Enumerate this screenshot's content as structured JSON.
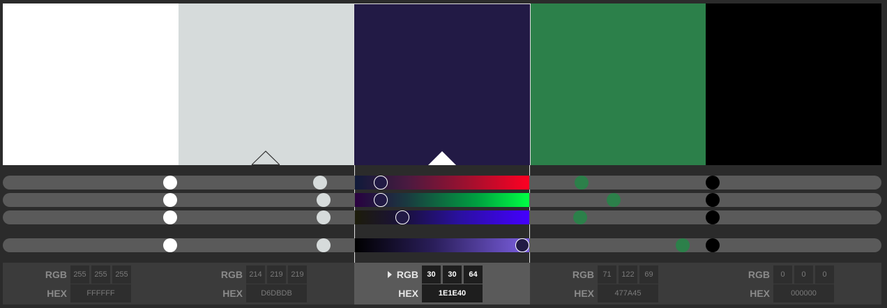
{
  "palette": {
    "selected_index": 2,
    "swatches": [
      {
        "name": "white",
        "hex": "FFFFFF",
        "rgb": {
          "r": "255",
          "g": "255",
          "b": "255"
        },
        "color": "#ffffff",
        "r": 255,
        "g": 255,
        "b": 255,
        "luminance": 255
      },
      {
        "name": "light-gray",
        "hex": "D6DBDB",
        "rgb": {
          "r": "214",
          "g": "219",
          "b": "219"
        },
        "color": "#d6dbdb",
        "r": 214,
        "g": 219,
        "b": 219,
        "luminance": 219
      },
      {
        "name": "dark-indigo",
        "hex": "1E1E40",
        "rgb": {
          "r": "30",
          "g": "30",
          "b": "64"
        },
        "color": "#221a45",
        "r": 30,
        "g": 30,
        "b": 64,
        "luminance": 255
      },
      {
        "name": "green",
        "hex": "477A45",
        "rgb": {
          "r": "71",
          "g": "122",
          "b": "69"
        },
        "color": "#2c804a",
        "r": 71,
        "g": 122,
        "b": 69,
        "luminance": 190
      },
      {
        "name": "black",
        "hex": "000000",
        "rgb": {
          "r": "0",
          "g": "0",
          "b": "0"
        },
        "color": "#000000",
        "r": 0,
        "g": 0,
        "b": 0,
        "luminance": 30
      }
    ]
  },
  "labels": {
    "rgb": "RGB",
    "hex": "HEX"
  },
  "colors": {
    "track": "#5a5a5a",
    "red_gradient_end": "#ff0022",
    "green_gradient_end": "#00ff44",
    "blue_gradient_end": "#4400ff",
    "lum_gradient_end": "#7b5fe0"
  }
}
